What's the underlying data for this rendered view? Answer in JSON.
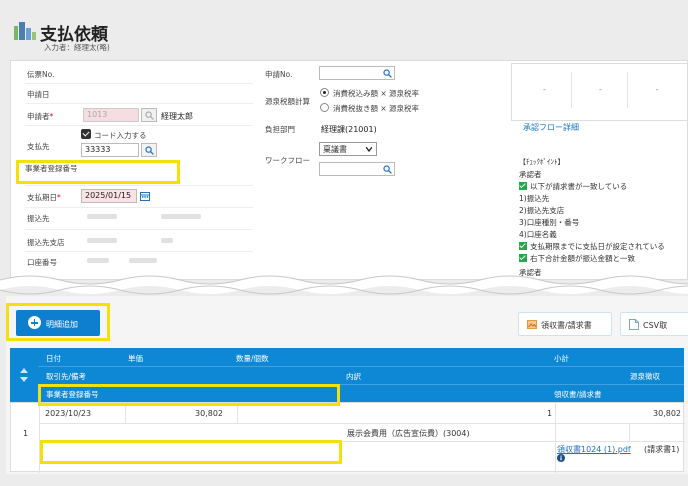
{
  "header": {
    "title": "支払依頼",
    "subtitle": "入力者：経理太(略)"
  },
  "form_left": {
    "denpyo_no_label": "伝票No.",
    "shinsei_date_label": "申請日",
    "shinseisha_label": "申請者",
    "required_mark": "*",
    "shinseisha_code": "1013",
    "shinseisha_name": "経理太郎",
    "shiharaisaki_label": "支払先",
    "code_input_label": "コード入力する",
    "shiharaisaki_code": "33333",
    "jigyosha_label": "事業者登録番号",
    "shiharai_kijitsu_label": "支払期日",
    "shiharai_kijitsu_value": "2025/01/15",
    "furikomisaki_label": "振込先",
    "furikomisaki_shiten_label": "振込先支店",
    "koza_label": "口座番号"
  },
  "form_mid": {
    "shinsei_no_label": "申請No.",
    "gensen_label": "源泉税額計算",
    "radio1": "消費税込み額 × 源泉税率",
    "radio2": "消費税抜き額 × 源泉税率",
    "futan_label": "負担部門",
    "futan_value": "経理課(21001)",
    "workflow_label": "ワークフロー",
    "workflow_value": "稟議書"
  },
  "approval": {
    "cells": [
      "-",
      "-",
      "-"
    ],
    "link": "承認フロー詳細"
  },
  "checkpoints": {
    "title": "【ﾁｪｯｸﾎﾟｲﾝﾄ】",
    "approver": "承認者",
    "items": [
      "以下が請求書が一致している",
      "1)振込先",
      "2)振込先支店",
      "3)口座種別・番号",
      "4)口座名義",
      "支払期限までに支払日が設定されている",
      "右下合計金額が振込金額と一致"
    ],
    "trailing": "承認者"
  },
  "toolbar": {
    "add_label": "明細追加",
    "receipt_label": "領収書/請求書",
    "csv_label": "CSV取"
  },
  "table": {
    "header_row1": {
      "date": "日付",
      "unit_price": "単価",
      "qty": "数量/個数",
      "subtotal": "小計"
    },
    "header_row2": {
      "partner": "取引先/備考",
      "breakdown": "内訳",
      "gensen": "源泉徴収"
    },
    "header_row3": {
      "jigyosha": "事業者登録番号",
      "receipt": "領収書/請求書"
    },
    "row": {
      "index": "1",
      "date": "2023/10/23",
      "unit_price": "30,802",
      "qty": "1",
      "subtotal": "30,802",
      "breakdown": "展示会費用（広告宣伝費）(3004)",
      "receipt_link": "領収書1024 (1).pdf",
      "receipt_note": "(請求書1)"
    }
  },
  "colors": {
    "accent": "#0e88d4",
    "highlight": "#f5e10a",
    "link": "#1a73c8"
  }
}
